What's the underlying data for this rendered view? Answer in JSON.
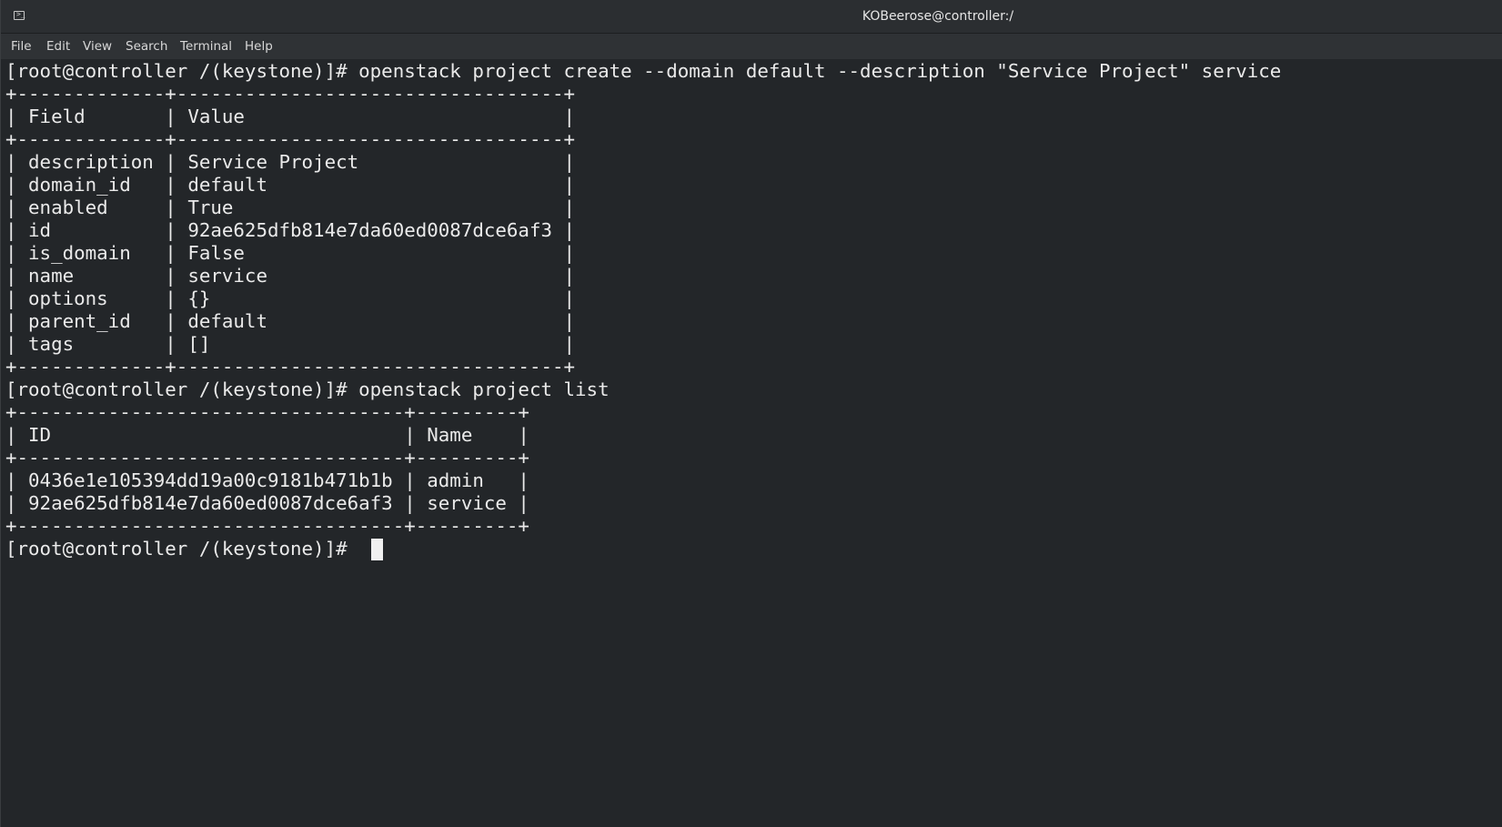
{
  "window": {
    "title": "KOBeerose@controller:/",
    "icon": "terminal-icon"
  },
  "menu": {
    "items": [
      "File",
      "Edit",
      "View",
      "Search",
      "Terminal",
      "Help"
    ]
  },
  "terminal": {
    "lines": [
      "[root@controller /(keystone)]# openstack project create --domain default --description \"Service Project\" service",
      "+-------------+----------------------------------+",
      "| Field       | Value                            |",
      "+-------------+----------------------------------+",
      "| description | Service Project                  |",
      "| domain_id   | default                          |",
      "| enabled     | True                             |",
      "| id          | 92ae625dfb814e7da60ed0087dce6af3 |",
      "| is_domain   | False                            |",
      "| name        | service                          |",
      "| options     | {}                               |",
      "| parent_id   | default                          |",
      "| tags        | []                               |",
      "+-------------+----------------------------------+",
      "[root@controller /(keystone)]# openstack project list",
      "+----------------------------------+---------+",
      "| ID                               | Name    |",
      "+----------------------------------+---------+",
      "| 0436e1e105394dd19a00c9181b471b1b | admin   |",
      "| 92ae625dfb814e7da60ed0087dce6af3 | service |",
      "+----------------------------------+---------+",
      "[root@controller /(keystone)]# "
    ]
  },
  "colors": {
    "background": "#232629",
    "foreground": "#eaeaea",
    "titlebar": "#2b2e31",
    "menubar": "#2f3235"
  }
}
